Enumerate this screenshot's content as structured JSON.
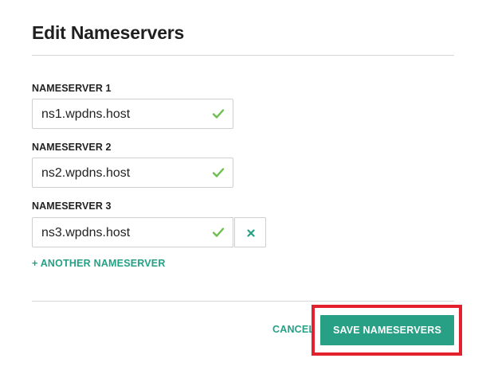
{
  "dialog": {
    "title": "Edit Nameservers"
  },
  "nameservers": [
    {
      "label": "NAMESERVER 1",
      "value": "ns1.wpdns.host",
      "valid": true,
      "removable": false
    },
    {
      "label": "NAMESERVER 2",
      "value": "ns2.wpdns.host",
      "valid": true,
      "removable": false
    },
    {
      "label": "NAMESERVER 3",
      "value": "ns3.wpdns.host",
      "valid": true,
      "removable": true
    }
  ],
  "actions": {
    "add_label": "+ ANOTHER NAMESERVER",
    "cancel_label": "CANCEL",
    "save_label": "SAVE NAMESERVERS"
  },
  "icons": {
    "valid": "check-icon",
    "remove": "close-icon"
  },
  "colors": {
    "accent": "#27a085",
    "check": "#6cbf4f",
    "highlight": "#e3202e"
  }
}
